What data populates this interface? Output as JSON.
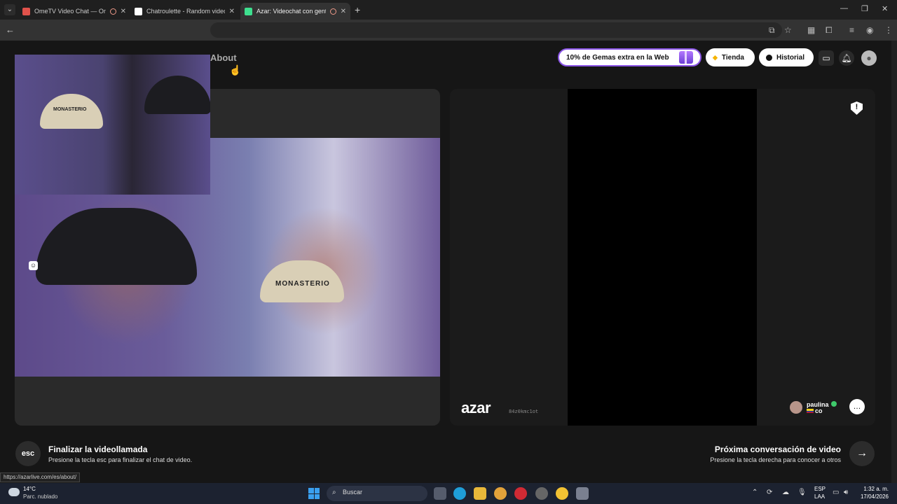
{
  "browser": {
    "tabs": [
      {
        "title": "OmeTV Video Chat — Ome",
        "favicon_color": "#e0524b",
        "recording": true,
        "active": false
      },
      {
        "title": "Chatroulette - Random video c",
        "favicon_color": "#ffffff",
        "recording": false,
        "active": false
      },
      {
        "title": "Azar: Videochat con gente",
        "favicon_color": "#3ee08f",
        "recording": true,
        "active": true
      }
    ],
    "new_tab_icon": "plus-icon",
    "status_url": "https://azarlive.com/es/about/"
  },
  "header": {
    "about_label": "About",
    "promo_label": "10% de Gemas extra en la Web",
    "store_label": "Tienda",
    "history_label": "Historial",
    "accent_color": "#8b55e6"
  },
  "left_video": {
    "pip_cap_text": "MONASTERIO",
    "main_cap_text": "MONASTERIO"
  },
  "right_panel": {
    "logo_text": "azar",
    "session_id": "84z0kmc1ot",
    "partner_name": "paulina",
    "partner_country": "co",
    "online_color": "#3ec96a"
  },
  "footer": {
    "esc_key": "esc",
    "end_title": "Finalizar la videollamada",
    "end_sub": "Presione la tecla esc para finalizar el chat de video.",
    "next_title": "Próxima conversación de video",
    "next_sub": "Presione la tecla derecha para conocer a otros"
  },
  "taskbar": {
    "temperature": "14°C",
    "condition": "Parc. nublado",
    "search_label": "Buscar",
    "lang_line1": "ESP",
    "lang_line2": "LAA",
    "time": "1:32 a. m.",
    "date": "17/04/2026"
  }
}
